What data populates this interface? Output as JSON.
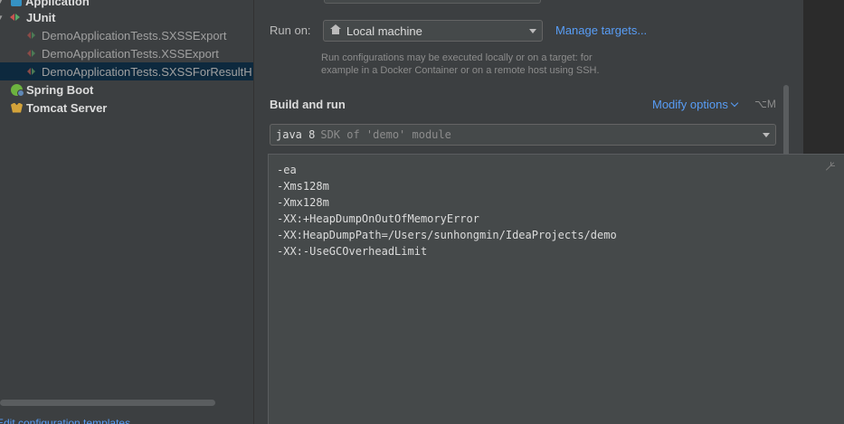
{
  "tree": {
    "items": [
      {
        "label": "Application",
        "kind": "app"
      },
      {
        "label": "JUnit",
        "kind": "junit"
      },
      {
        "label": "DemoApplicationTests.SXSSExport",
        "kind": "test"
      },
      {
        "label": "DemoApplicationTests.XSSExport",
        "kind": "test"
      },
      {
        "label": "DemoApplicationTests.SXSSForResultH",
        "kind": "test",
        "selected": true
      },
      {
        "label": "Spring Boot",
        "kind": "spring"
      },
      {
        "label": "Tomcat Server",
        "kind": "tomcat"
      }
    ],
    "bottom_link": "Edit configuration templates..."
  },
  "config": {
    "run_on_label": "Run on:",
    "run_on_value": "Local machine",
    "manage_targets": "Manage targets...",
    "hint": "Run configurations may be executed locally or on a target: for example in a Docker Container or on a remote host using SSH.",
    "build_and_run": "Build and run",
    "modify_options": "Modify options",
    "modify_shortcut": "⌥M",
    "sdk_main": "java 8",
    "sdk_sub": "SDK of 'demo' module"
  },
  "vm_options": {
    "lines": [
      "-ea",
      "-Xms128m",
      "-Xmx128m",
      "-XX:+HeapDumpOnOutOfMemoryError",
      "-XX:HeapDumpPath=/Users/sunhongmin/IdeaProjects/demo",
      "-XX:-UseGCOverheadLimit"
    ]
  },
  "colors": {
    "background": "#3c3f41",
    "link": "#589df6",
    "selection": "#0d293e",
    "editor": "#45494a"
  }
}
